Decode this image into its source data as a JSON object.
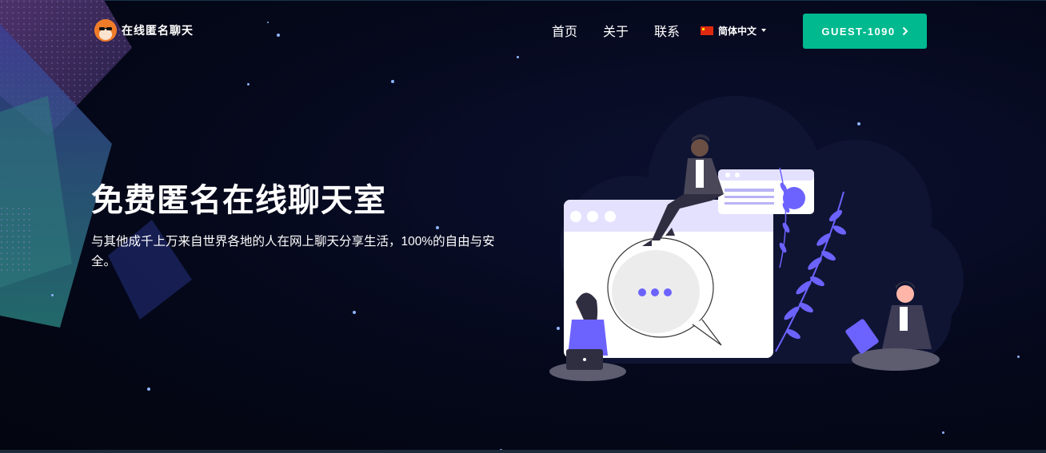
{
  "header": {
    "logo_text": "在线匿名聊天",
    "nav": {
      "home": "首页",
      "about": "关于",
      "contact": "联系"
    },
    "language": {
      "selected": "简体中文",
      "flag_icon": "china-flag-icon"
    },
    "guest_button": {
      "label": "GUEST-1090",
      "icon": "chevron-right-icon"
    }
  },
  "hero": {
    "title": "免费匿名在线聊天室",
    "subtitle": "与其他成千上万来自世界各地的人在网上聊天分享生活，100%的自由与安全。"
  },
  "colors": {
    "background": "#05081a",
    "accent": "#00b98e",
    "illustration_purple": "#6c63ff",
    "logo_orange": "#f07c2a"
  }
}
